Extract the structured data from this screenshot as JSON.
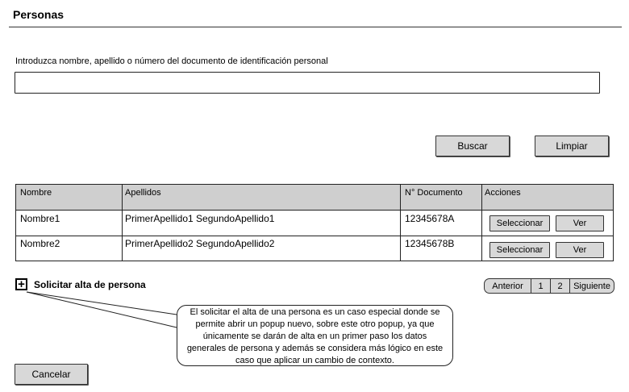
{
  "page": {
    "title": "Personas"
  },
  "search": {
    "label": "Introduzca nombre, apellido o número del documento de identificación personal",
    "value": "",
    "placeholder": ""
  },
  "actions": {
    "search_label": "Buscar",
    "clear_label": "Limpiar"
  },
  "table": {
    "headers": [
      "Nombre",
      "Apellidos",
      "N° Documento",
      "Acciones"
    ],
    "rows": [
      {
        "nombre": "Nombre1",
        "apellidos": "PrimerApellido1 SegundoApellido1",
        "documento": "12345678A"
      },
      {
        "nombre": "Nombre2",
        "apellidos": "PrimerApellido2 SegundoApellido2",
        "documento": "12345678B"
      }
    ],
    "select_label": "Seleccionar",
    "view_label": "Ver"
  },
  "request_new": {
    "icon": "plus-square-icon",
    "label": "Solicitar alta de persona"
  },
  "pagination": {
    "prev_label": "Anterior",
    "pages": [
      "1",
      "2"
    ],
    "next_label": "Siguiente"
  },
  "note": {
    "text": "El solicitar el alta de una persona es un caso especial donde se permite abrir un popup nuevo, sobre este otro popup, ya que únicamente se darán de alta en un primer paso los datos generales de persona y además se considera más lógico en este caso que aplicar un cambio de contexto."
  },
  "footer": {
    "cancel_label": "Cancelar"
  }
}
